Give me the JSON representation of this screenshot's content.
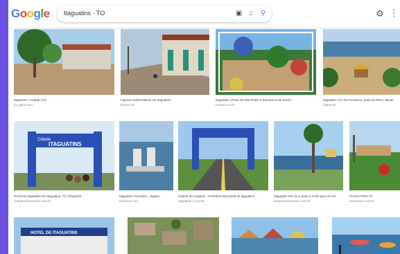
{
  "app": {
    "logo": {
      "b1": "G",
      "r1": "o",
      "y1": "o",
      "b2": "g",
      "g1": "l",
      "r2": "e"
    },
    "search_query": "Itaguatins - TO",
    "icons": [
      "camera-icon",
      "mic-icon",
      "search-icon",
      "gear-icon",
      "apps-icon"
    ]
  },
  "results": [
    {
      "caption": "Itaguatins | Cidade | G1",
      "source": "g1.globo.com"
    },
    {
      "caption": "Figuras emblemáticas em Itaguatins",
      "source": "jtnews.net"
    },
    {
      "caption": "Itaguatins | Praia do São Pedro e Remansos de Sonho",
      "source": "tocantins.com"
    },
    {
      "caption": "Itaguatins TO, Rio Tocantins, praia de Ilhas | Minas",
      "source": "maps.net"
    },
    {
      "caption": "Portal de Itaguatins em Itaguatins, TO | Registrar",
      "source": "cidadesdotocantins.com.br"
    },
    {
      "caption": "Itaguatins Tocantins - viagem",
      "source": "facebook.com"
    },
    {
      "caption": "Galeria de Imagens - Prefeitura Municipal de Itaguatins",
      "source": "itaguatins.to.gov.br"
    },
    {
      "caption": "Itaguatins tem rio e praia e muito para se ver",
      "source": "amazoniatocantins.com.br"
    },
    {
      "caption": "ITAGUATINS TO",
      "source": "achebrasil.com.br"
    }
  ],
  "gate": {
    "line1": "Cidade",
    "line2": "ITAGUATINS"
  },
  "hotel_sign": "HOTEL DE ITAGUATINS"
}
